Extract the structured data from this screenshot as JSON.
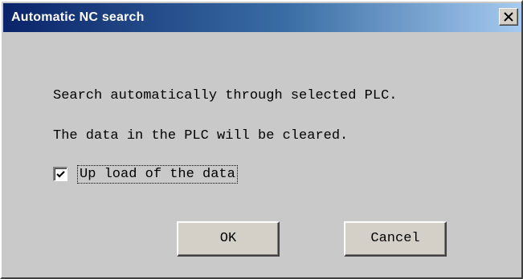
{
  "window": {
    "title": "Automatic NC search",
    "close_icon": "close-icon"
  },
  "message": {
    "line1": "Search automatically through selected PLC.",
    "line2": "The data in the PLC will be cleared."
  },
  "upload_option": {
    "label": "Up load of the data",
    "checked": true
  },
  "buttons": {
    "ok": "OK",
    "cancel": "Cancel"
  }
}
